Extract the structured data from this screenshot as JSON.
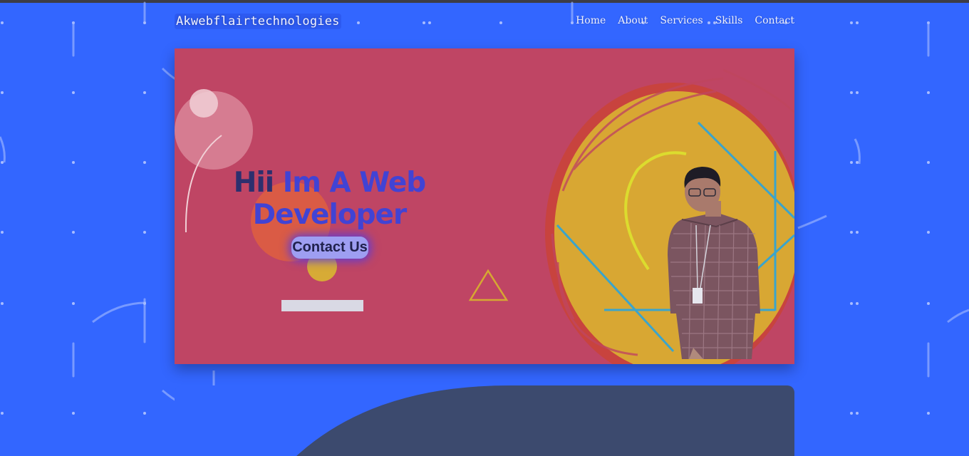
{
  "header": {
    "brand": "Akwebflairtechnologies",
    "nav": [
      "Home",
      "About",
      "Services",
      "Skills",
      "Contact"
    ]
  },
  "hero": {
    "headline_part1": "Hii",
    "headline_part2": "Im A Web",
    "headline_line2": "Developer",
    "cta_label": "Contact Us"
  },
  "colors": {
    "page_bg": "#3366ff",
    "hero_bg": "#bf4564",
    "accent_yellow": "#d8a733",
    "headline_dark": "#2c2f6e",
    "headline_blue": "#4143d4",
    "next_section": "#3c4a6e"
  }
}
